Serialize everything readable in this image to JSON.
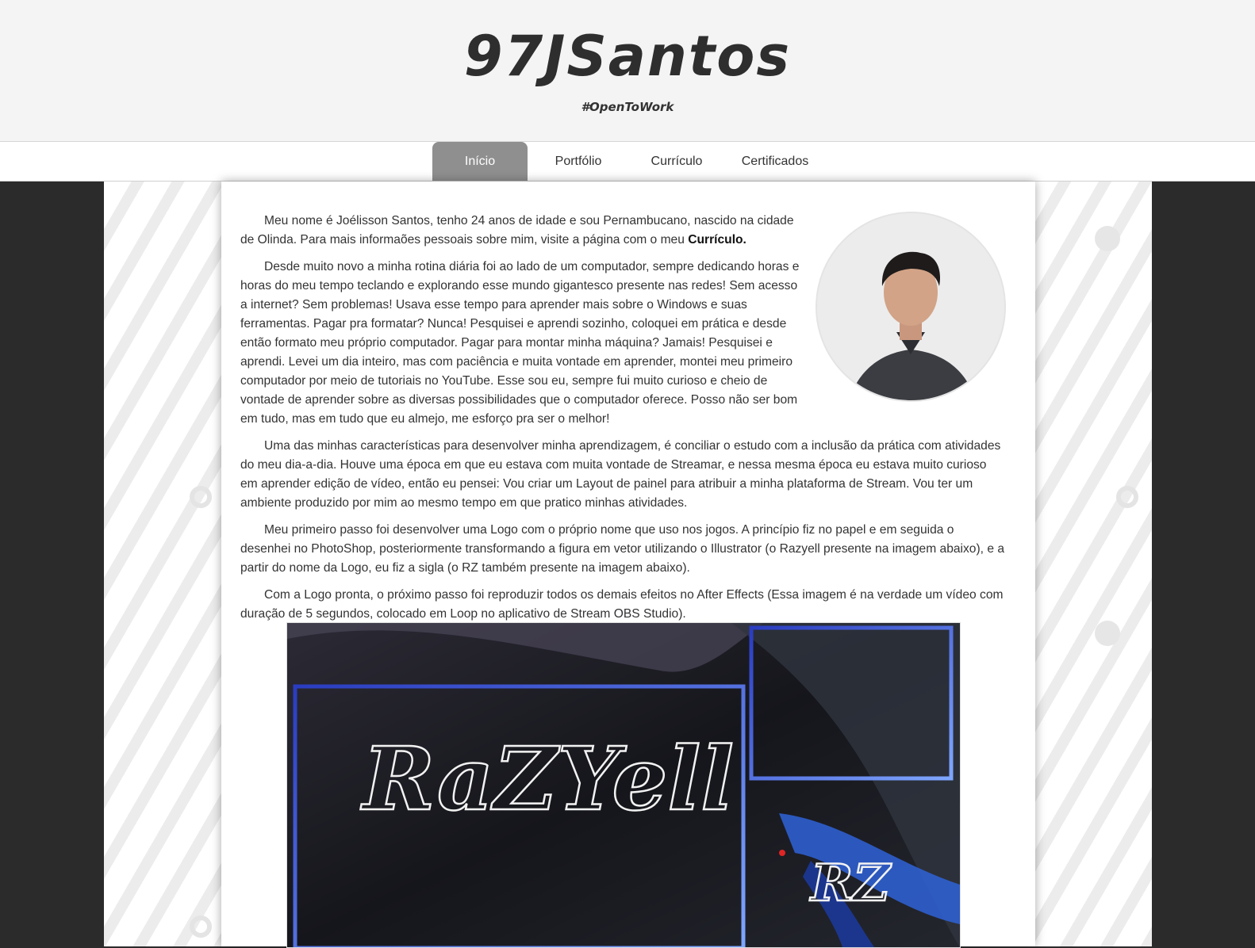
{
  "header": {
    "title": "97JSantos",
    "tagline": "#OpenToWork"
  },
  "nav": {
    "items": [
      {
        "label": "Início",
        "active": true
      },
      {
        "label": "Portfólio"
      },
      {
        "label": "Currículo"
      },
      {
        "label": "Certificados"
      }
    ]
  },
  "main": {
    "p1_text": "Meu nome é Joélisson Santos, tenho 24 anos de idade e sou Pernambucano, nascido na cidade de Olinda. Para mais informaões pessoais sobre mim, visite a página com o meu ",
    "p1_link": "Currículo.",
    "p2": "Desde muito novo a minha rotina diária foi ao lado de um computador, sempre dedicando horas e horas do meu tempo teclando e explorando esse mundo gigantesco presente nas redes! Sem acesso a internet? Sem problemas! Usava esse tempo para aprender mais sobre o Windows e suas ferramentas. Pagar pra formatar? Nunca! Pesquisei e aprendi sozinho, coloquei em prática e desde então formato meu próprio computador. Pagar para montar minha máquina? Jamais! Pesquisei e aprendi. Levei um dia inteiro, mas com paciência e muita vontade em aprender, montei meu primeiro computador por meio de tutoriais no YouTube. Esse sou eu, sempre fui muito curioso e cheio de vontade de aprender sobre as diversas possibilidades que o computador oferece. Posso não ser bom em tudo, mas em tudo que eu almejo, me esforço pra ser o melhor!",
    "p3": "Uma das minhas características para desenvolver minha aprendizagem, é conciliar o estudo com a inclusão da prática com atividades do meu dia-a-dia. Houve uma época em que eu estava com muita vontade de Streamar, e nessa mesma época eu estava muito curioso em aprender edição de vídeo, então eu pensei: Vou criar um Layout de painel para atribuir a minha plataforma de Stream. Vou ter um ambiente produzido por mim ao mesmo tempo em que pratico minhas atividades.",
    "p4": "Meu primeiro passo foi desenvolver uma Logo com o próprio nome que uso nos jogos. A princípio fiz no papel e em seguida o desenhei no PhotoShop, posteriormente transformando a figura em vetor utilizando o Illustrator (o Razyell presente na imagem abaixo), e a partir do nome da Logo, eu fiz a sigla (o RZ também presente na imagem abaixo).",
    "p5": "Com a Logo pronta, o próximo passo foi reproduzir todos os demais efeitos no After Effects (Essa imagem é na verdade um vídeo com duração de 5 segundos, colocado em Loop no aplicativo de Stream OBS Studio).",
    "image_logo_text": "RaZYell",
    "image_monogram_text": "RZ"
  }
}
